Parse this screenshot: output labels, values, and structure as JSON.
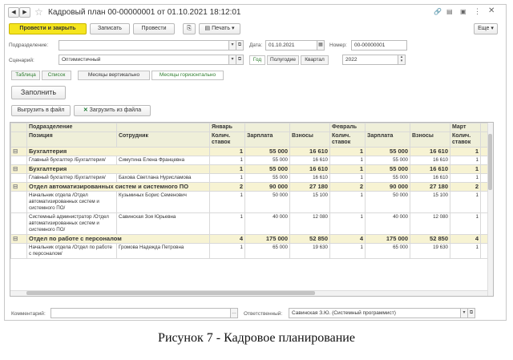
{
  "title": "Кадровый план 00-00000001 от 01.10.2021 18:12:01",
  "toolbar": {
    "post_close": "Провести и закрыть",
    "save": "Записать",
    "post": "Провести",
    "print": "Печать",
    "more": "Еще"
  },
  "form": {
    "subdivision_label": "Подразделение:",
    "subdivision_value": "",
    "date_label": "Дата:",
    "date_value": "01.10.2021",
    "number_label": "Номер:",
    "number_value": "00-00000001",
    "scenario_label": "Сценарий:",
    "scenario_value": "Оптимистичный",
    "periods": [
      "Год",
      "Полугодие",
      "Квартал"
    ],
    "year_value": "2022"
  },
  "view_tabs": [
    "Таблица",
    "Список",
    "Месяцы вертикально",
    "Месяцы горизонтально"
  ],
  "fill_button": "Заполнить",
  "export_button": "Выгрузить в файл",
  "import_button": "Загрузить из файла",
  "table": {
    "header1": [
      "Подразделение",
      "",
      "Январь",
      "",
      "",
      "Февраль",
      "",
      "",
      "Март",
      ""
    ],
    "header2": [
      "Позиция",
      "Сотрудник",
      "Колич. ставок",
      "Зарплата",
      "Взносы",
      "Колич. ставок",
      "Зарплата",
      "Взносы",
      "Колич. ставок",
      ""
    ],
    "rows": [
      {
        "type": "g",
        "c": [
          "Бухгалтерия",
          "",
          "1",
          "55 000",
          "16 610",
          "1",
          "55 000",
          "16 610",
          "1",
          ""
        ]
      },
      {
        "type": "d",
        "c": [
          "Главный бухгалтер /Бухгалтерия/",
          "Симутина Елена Францевна",
          "1",
          "55 000",
          "16 610",
          "1",
          "55 000",
          "16 610",
          "1",
          ""
        ]
      },
      {
        "type": "g",
        "c": [
          "Бухгалтерия",
          "",
          "1",
          "55 000",
          "16 610",
          "1",
          "55 000",
          "16 610",
          "1",
          ""
        ]
      },
      {
        "type": "d",
        "c": [
          "Главный бухгалтер /Бухгалтерия/",
          "Бахова Светлана Нурисламова",
          "1",
          "55 000",
          "16 610",
          "1",
          "55 000",
          "16 610",
          "1",
          ""
        ]
      },
      {
        "type": "g",
        "c": [
          "Отдел автоматизированных систем и системного ПО",
          "",
          "2",
          "90 000",
          "27 180",
          "2",
          "90 000",
          "27 180",
          "2",
          ""
        ]
      },
      {
        "type": "d",
        "c": [
          "Начальник отдела /Отдел автоматизированных систем и системного ПО/",
          "Кузьминых Борис Семенович",
          "1",
          "50 000",
          "15 100",
          "1",
          "50 000",
          "15 100",
          "1",
          ""
        ]
      },
      {
        "type": "d",
        "c": [
          "Системный администратор /Отдел автоматизированных систем и системного ПО/",
          "Савинская Зоя Юрьевна",
          "1",
          "40 000",
          "12 080",
          "1",
          "40 000",
          "12 080",
          "1",
          ""
        ]
      },
      {
        "type": "g",
        "c": [
          "Отдел по работе с персоналом",
          "",
          "4",
          "175 000",
          "52 850",
          "4",
          "175 000",
          "52 850",
          "4",
          ""
        ]
      },
      {
        "type": "d",
        "c": [
          "Начальник отдела /Отдел по работе с персоналом/",
          "Громова Надежда Петровна",
          "1",
          "65 000",
          "19 630",
          "1",
          "65 000",
          "19 630",
          "1",
          ""
        ]
      }
    ]
  },
  "footer": {
    "comment_label": "Комментарий:",
    "comment_value": "",
    "responsible_label": "Ответственный:",
    "responsible_value": "Савинская З.Ю. (Системный программист)"
  },
  "caption": "Рисунок 7 - Кадровое планирование"
}
